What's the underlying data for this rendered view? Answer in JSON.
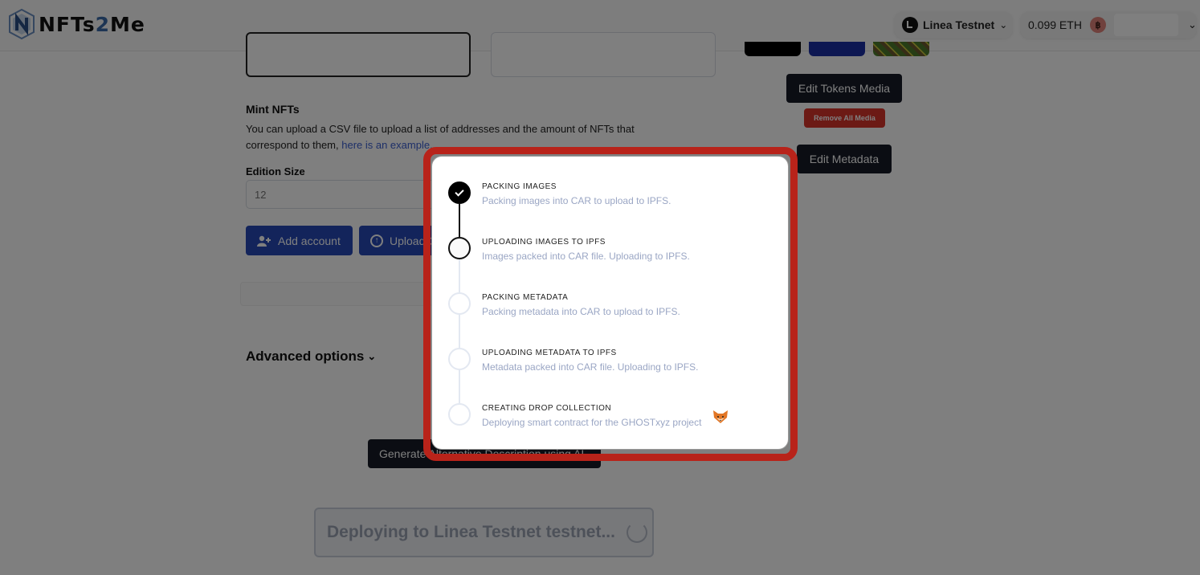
{
  "header": {
    "logo_text_a": "NFTs",
    "logo_text_two": "2",
    "logo_text_b": "Me",
    "network": {
      "label": "Linea Testnet",
      "icon": "linea-icon"
    },
    "wallet": {
      "balance": "0.099 ETH",
      "avatar_icon": "wallet-avatar-icon"
    }
  },
  "media_panel": {
    "edit_tokens_label": "Edit Tokens Media",
    "remove_media_label": "Remove All Media",
    "edit_metadata_label": "Edit Metadata"
  },
  "mint": {
    "title": "Mint NFTs",
    "description": "You can upload a CSV file to upload a list of addresses and the amount of NFTs that correspond to them, ",
    "example_link": "here is an example.",
    "edition_label": "Edition Size",
    "edition_placeholder": "12",
    "add_account_label": "Add account",
    "upload_label": "Upload CSV"
  },
  "advanced_label": "Advanced options",
  "generate_label": "Generate Alternative Description using AI",
  "deploy_label": "Deploying to Linea Testnet testnet...",
  "progress_modal": {
    "steps": [
      {
        "title": "PACKING IMAGES",
        "desc": "Packing images into CAR to upload to IPFS.",
        "status": "done"
      },
      {
        "title": "UPLOADING IMAGES TO IPFS",
        "desc": "Images packed into CAR file. Uploading to IPFS.",
        "status": "active"
      },
      {
        "title": "PACKING METADATA",
        "desc": "Packing metadata into CAR to upload to IPFS.",
        "status": "pending"
      },
      {
        "title": "UPLOADING METADATA TO IPFS",
        "desc": "Metadata packed into CAR file. Uploading to IPFS.",
        "status": "pending"
      },
      {
        "title": "CREATING DROP COLLECTION",
        "desc": "Deploying smart contract for the GHOSTxyz project",
        "status": "pending",
        "icon": "metamask-fox-icon"
      }
    ]
  },
  "colors": {
    "highlight_frame": "#b8231a",
    "primary_blue": "#2749b6",
    "dark_button": "#161b26",
    "danger": "#d9342b",
    "step_desc": "#9aa6c4"
  }
}
